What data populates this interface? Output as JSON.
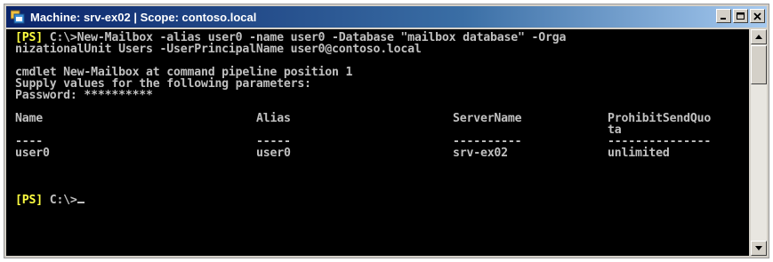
{
  "window": {
    "title": "Machine: srv-ex02 | Scope: contoso.local",
    "app_icon": "powershell-window-icon",
    "controls": [
      "minimize-icon",
      "maximize-icon",
      "close-icon"
    ]
  },
  "console": {
    "command_prompt_tag": "[PS]",
    "command_prompt_path": " C:\\>",
    "command_line_1": "New-Mailbox -alias user0 -name user0 -Database \"mailbox database\" -Orga",
    "command_line_2": "nizationalUnit Users -UserPrincipalName user0@contoso.local",
    "cmdlet_line": "cmdlet New-Mailbox at command pipeline position 1",
    "supply_line": "Supply values for the following parameters:",
    "password_line": "Password: **********",
    "table": {
      "headers": [
        "Name",
        "Alias",
        "ServerName",
        "ProhibitSendQuo"
      ],
      "header_wrap_4": "ta",
      "separators": [
        "----",
        "-----",
        "----------",
        "---------------"
      ],
      "row": [
        "user0",
        "user0",
        "srv-ex02",
        "unlimited"
      ]
    },
    "final_prompt_tag": "[PS]",
    "final_prompt_path": " C:\\>",
    "prompt_tag_color": "#ffff40",
    "text_color": "#c0c0c0",
    "background_color": "#000000"
  },
  "scrollbar": {
    "up_icon": "scroll-up-arrow-icon",
    "down_icon": "scroll-down-arrow-icon"
  }
}
